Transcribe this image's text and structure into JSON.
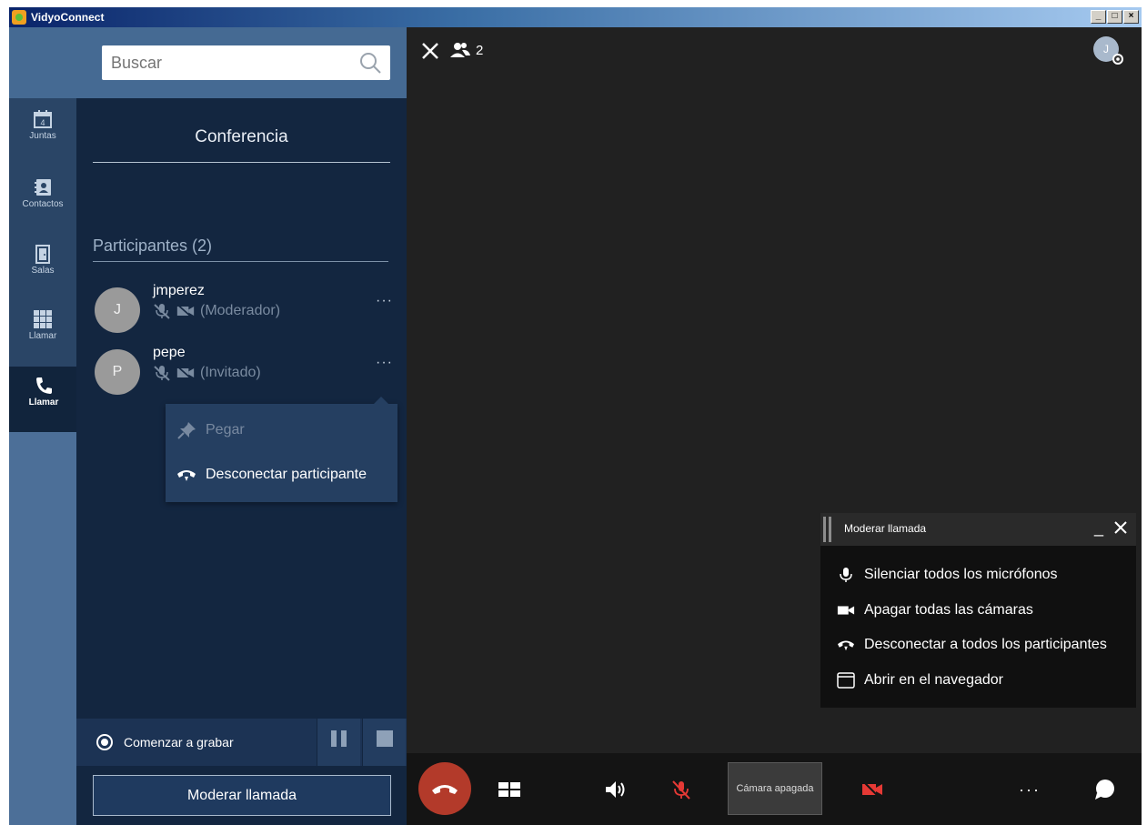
{
  "window": {
    "title": "VidyoConnect",
    "minimize": "_",
    "maximize": "□",
    "close": "×"
  },
  "search": {
    "placeholder": "Buscar"
  },
  "nav": {
    "items": [
      {
        "label": "Juntas",
        "badge": "4"
      },
      {
        "label": "Contactos"
      },
      {
        "label": "Salas"
      },
      {
        "label": "Llamar"
      },
      {
        "label": "Llamar",
        "active": true
      }
    ]
  },
  "conference": {
    "title": "Conferencia",
    "participants_title": "Participantes (2)",
    "participants": [
      {
        "initial": "J",
        "name": "jmperez",
        "role": "(Moderador)",
        "more": "···"
      },
      {
        "initial": "P",
        "name": "pepe",
        "role": "(Invitado)",
        "more": "···"
      }
    ]
  },
  "context_menu": {
    "items": [
      {
        "label": "Pegar",
        "enabled": false
      },
      {
        "label": "Desconectar participante",
        "enabled": true
      }
    ]
  },
  "recording": {
    "label": "Comenzar a grabar"
  },
  "moderate_button": {
    "label": "Moderar llamada"
  },
  "stage": {
    "participant_count": "2",
    "self_initial": "J"
  },
  "moderate_popup": {
    "title": "Moderar llamada",
    "minimize": "_",
    "items": [
      {
        "label": "Silenciar todos los micrófonos",
        "icon": "microphone-icon"
      },
      {
        "label": "Apagar todas las cámaras",
        "icon": "camera-icon"
      },
      {
        "label": "Desconectar a todos los participantes",
        "icon": "hangup-icon"
      },
      {
        "label": "Abrir en el navegador",
        "icon": "browser-window-icon"
      }
    ]
  },
  "toolbar": {
    "camera_off_label": "Cámara apagada",
    "more_label": "···"
  },
  "colors": {
    "rail": "#2a4566",
    "panel": "#132640",
    "stage": "#212121",
    "hangup": "#b33a2a",
    "muted_red": "#e53935"
  }
}
